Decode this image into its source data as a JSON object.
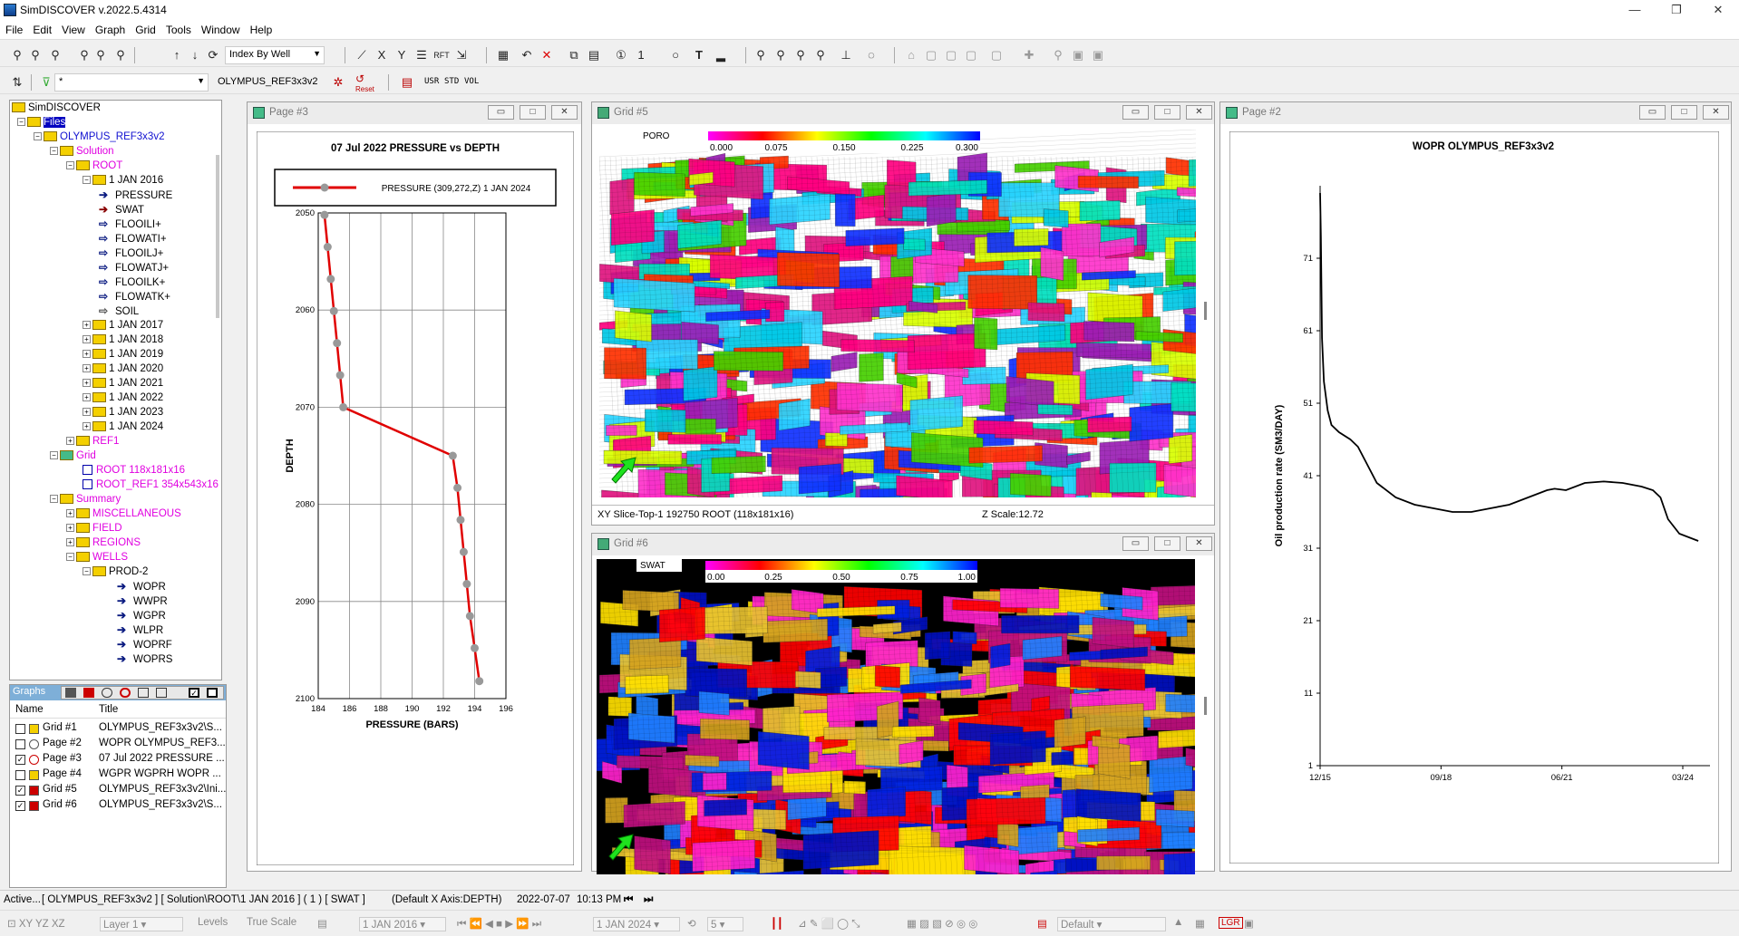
{
  "app": {
    "title": "SimDISCOVER v.2022.5.4314",
    "min": "—",
    "max": "❐",
    "close": "✕"
  },
  "menu": [
    "File",
    "Edit",
    "View",
    "Graph",
    "Grid",
    "Tools",
    "Window",
    "Help"
  ],
  "toolbar1": {
    "index_combo": "Index By Well"
  },
  "toolbar2": {
    "filter_combo": "*",
    "case_label": "OLYMPUS_REF3x3v2",
    "reset_label": "Reset",
    "usr_label": "USR",
    "std_label": "STD",
    "vol_label": "VOL"
  },
  "tree": {
    "root": "SimDISCOVER",
    "files": "Files",
    "case": "OLYMPUS_REF3x3v2",
    "solution": "Solution",
    "root_node": "ROOT",
    "date_open": "1 JAN 2016",
    "props": [
      "PRESSURE",
      "SWAT",
      "FLOOILI+",
      "FLOWATI+",
      "FLOOILJ+",
      "FLOWATJ+",
      "FLOOILK+",
      "FLOWATK+",
      "SOIL"
    ],
    "dates": [
      "1 JAN 2017",
      "1 JAN 2018",
      "1 JAN 2019",
      "1 JAN 2020",
      "1 JAN 2021",
      "1 JAN 2022",
      "1 JAN 2023",
      "1 JAN 2024"
    ],
    "ref1": "REF1",
    "grid": "Grid",
    "grid_items": [
      "ROOT 118x181x16",
      "ROOT_REF1 354x543x16"
    ],
    "summary": "Summary",
    "summary_items": [
      "MISCELLANEOUS",
      "FIELD",
      "REGIONS",
      "WELLS"
    ],
    "well": "PROD-2",
    "well_vectors": [
      "WOPR",
      "WWPR",
      "WGPR",
      "WLPR",
      "WOPRF",
      "WOPRS"
    ]
  },
  "graphs": {
    "header": "Graphs",
    "col_name": "Name",
    "col_title": "Title",
    "rows": [
      {
        "name": "Grid #1",
        "title": "OLYMPUS_REF3x3v2\\S...",
        "checked": false
      },
      {
        "name": "Page #2",
        "title": "WOPR OLYMPUS_REF3...",
        "checked": false
      },
      {
        "name": "Page #3",
        "title": "07 Jul 2022 PRESSURE ...",
        "checked": true
      },
      {
        "name": "Page #4",
        "title": "WGPR WGPRH WOPR ...",
        "checked": false
      },
      {
        "name": "Grid #5",
        "title": "OLYMPUS_REF3x3v2\\Ini...",
        "checked": true
      },
      {
        "name": "Grid #6",
        "title": "OLYMPUS_REF3x3v2\\S...",
        "checked": true
      }
    ]
  },
  "page3": {
    "window_title": "Page #3"
  },
  "grid5": {
    "window_title": "Grid #5",
    "property": "PORO",
    "scale": [
      "0.000",
      "0.075",
      "0.150",
      "0.225",
      "0.300"
    ],
    "status_slice": "XY Slice-Top-1 192750  ROOT (118x181x16)",
    "status_z": "Z Scale:12.72"
  },
  "grid6": {
    "window_title": "Grid #6",
    "property": "SWAT",
    "scale": [
      "0.00",
      "0.25",
      "0.50",
      "0.75",
      "1.00"
    ]
  },
  "page2": {
    "window_title": "Page #2"
  },
  "chart_data": [
    {
      "type": "line",
      "title": "07 Jul 2022 PRESSURE vs DEPTH",
      "xlabel": "PRESSURE (BARS)",
      "ylabel": "DEPTH",
      "legend": "PRESSURE (309,272,Z) 1 JAN 2024",
      "xlim": [
        184,
        196
      ],
      "ylim": [
        2100,
        2050
      ],
      "xticks": [
        184,
        186,
        188,
        190,
        192,
        194,
        196
      ],
      "yticks": [
        2050,
        2060,
        2070,
        2080,
        2090,
        2100
      ],
      "series": [
        {
          "name": "PRESSURE (309,272,Z) 1 JAN 2024",
          "color": "#e00000",
          "x": [
            184.4,
            184.6,
            184.8,
            185.0,
            185.2,
            185.4,
            185.6,
            192.6,
            192.9,
            193.1,
            193.3,
            193.5,
            193.7,
            194.0,
            194.3
          ],
          "y": [
            2050.2,
            2053.5,
            2056.8,
            2060.1,
            2063.4,
            2066.7,
            2070.0,
            2075.0,
            2078.3,
            2081.6,
            2084.9,
            2088.2,
            2091.5,
            2094.8,
            2098.2
          ]
        }
      ]
    },
    {
      "type": "line",
      "title": "WOPR OLYMPUS_REF3x3v2",
      "ylabel": "Oil production rate (SM3/DAY)",
      "xlabel": "",
      "ylim": [
        1,
        81
      ],
      "yticks": [
        1,
        11,
        21,
        31,
        41,
        51,
        61,
        71
      ],
      "xticks": [
        "12/15",
        "09/18",
        "06/21",
        "03/24"
      ],
      "series": [
        {
          "name": "WOPR",
          "color": "#000000",
          "x": [
            0,
            0.2,
            0.5,
            1,
            2,
            3,
            5,
            8,
            10,
            12,
            15,
            20,
            25,
            30,
            35,
            40,
            45,
            50,
            55,
            60,
            62,
            65,
            70,
            75,
            80,
            85,
            88,
            90,
            92,
            95,
            100
          ],
          "y": [
            80,
            74,
            60,
            54,
            50,
            48,
            47,
            46,
            45,
            43,
            40,
            38,
            37,
            36.5,
            36,
            36,
            36.5,
            37,
            38,
            39,
            39.2,
            39,
            40,
            40.2,
            40,
            39.5,
            39,
            38,
            35,
            33,
            32
          ]
        }
      ]
    }
  ],
  "status": {
    "active": "Active...",
    "path": "[ OLYMPUS_REF3x3v2 ] [ Solution\\ROOT\\1 JAN 2016 ] ( 1 )  [ SWAT ]",
    "axis": "(Default X Axis:DEPTH)",
    "date": "2022-07-07",
    "time": "10:13 PM"
  },
  "bottom": {
    "layer": "Layer 1",
    "levels": "Levels",
    "truescale": "True Scale",
    "date1": "1 JAN 2016",
    "date2": "1 JAN 2024",
    "step": "5",
    "theme": "Default",
    "lgr": "LGR"
  },
  "colors": {
    "accent": "#0000c0",
    "magenta": "#e000e0",
    "selection": "#0000c0",
    "graphs_header": "#7eafd8"
  }
}
